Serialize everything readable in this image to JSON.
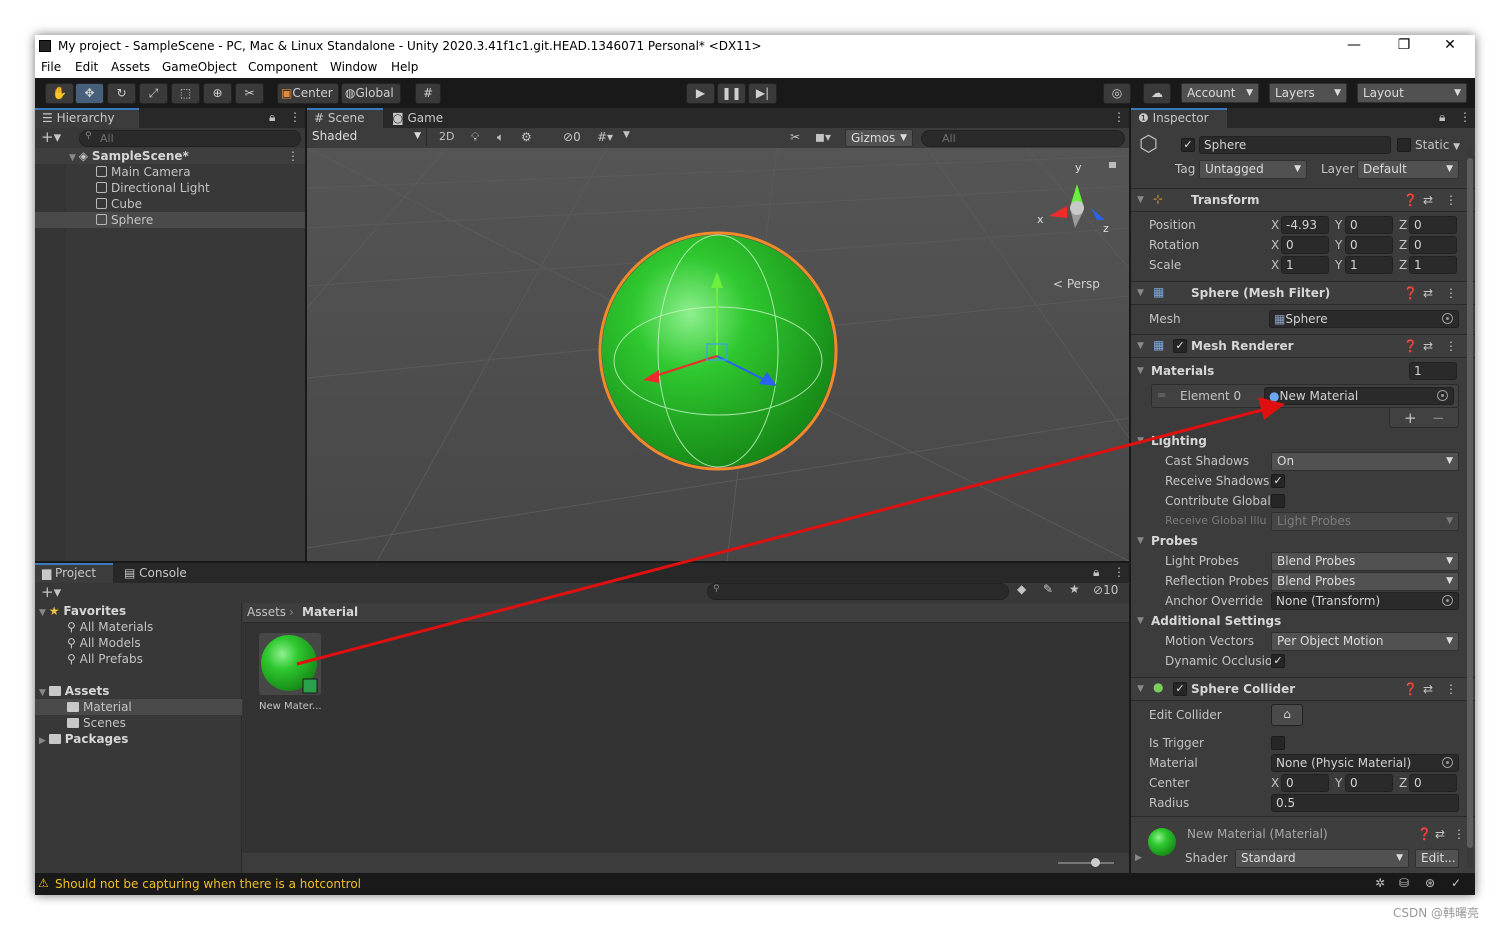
{
  "window": {
    "title": "My project - SampleScene - PC, Mac & Linux Standalone - Unity 2020.3.41f1c1.git.HEAD.1346071 Personal* <DX11>",
    "min": "—",
    "max": "❐",
    "close": "✕"
  },
  "menu": [
    "File",
    "Edit",
    "Assets",
    "GameObject",
    "Component",
    "Window",
    "Help"
  ],
  "toolbar": {
    "center": "Center",
    "global": "Global",
    "account": "Account",
    "layers": "Layers",
    "layout": "Layout"
  },
  "hierarchy": {
    "tab": "Hierarchy",
    "search_placeholder": "All",
    "scene": "SampleScene*",
    "items": [
      "Main Camera",
      "Directional Light",
      "Cube",
      "Sphere"
    ],
    "selected": "Sphere"
  },
  "scene": {
    "tabs": [
      "Scene",
      "Game"
    ],
    "shading": "Shaded",
    "mode_2d": "2D",
    "hidden_count": "0",
    "gizmos": "Gizmos",
    "search_placeholder": "All",
    "persp": "< Persp",
    "axis_x": "x",
    "axis_y": "y",
    "axis_z": "z"
  },
  "project": {
    "tabs": [
      "Project",
      "Console"
    ],
    "favorites": "Favorites",
    "fav_items": [
      "All Materials",
      "All Models",
      "All Prefabs"
    ],
    "assets": "Assets",
    "asset_items": [
      "Material",
      "Scenes"
    ],
    "packages": "Packages",
    "breadcrumb": [
      "Assets",
      "Material"
    ],
    "asset_tile": "New Mater...",
    "visibility_count": "10"
  },
  "inspector": {
    "tab": "Inspector",
    "name": "Sphere",
    "static": "Static",
    "tag_label": "Tag",
    "tag": "Untagged",
    "layer_label": "Layer",
    "layer": "Default",
    "transform": {
      "title": "Transform",
      "position": {
        "label": "Position",
        "x": "-4.93",
        "y": "0",
        "z": "0"
      },
      "rotation": {
        "label": "Rotation",
        "x": "0",
        "y": "0",
        "z": "0"
      },
      "scale": {
        "label": "Scale",
        "x": "1",
        "y": "1",
        "z": "1"
      }
    },
    "mesh_filter": {
      "title": "Sphere (Mesh Filter)",
      "mesh_label": "Mesh",
      "mesh": "Sphere"
    },
    "mesh_renderer": {
      "title": "Mesh Renderer",
      "materials": "Materials",
      "materials_count": "1",
      "element0": "Element 0",
      "element0_value": "New Material",
      "lighting": "Lighting",
      "cast_shadows": "Cast Shadows",
      "cast_shadows_value": "On",
      "receive_shadows": "Receive Shadows",
      "contribute_gi": "Contribute Global I",
      "receive_gi": "Receive Global Illu",
      "receive_gi_value": "Light Probes",
      "probes": "Probes",
      "light_probes": "Light Probes",
      "light_probes_value": "Blend Probes",
      "reflection_probes": "Reflection Probes",
      "reflection_probes_value": "Blend Probes",
      "anchor_override": "Anchor Override",
      "anchor_override_value": "None (Transform)",
      "additional": "Additional Settings",
      "motion_vectors": "Motion Vectors",
      "motion_vectors_value": "Per Object Motion",
      "dynamic_occlusion": "Dynamic Occlusioi"
    },
    "sphere_collider": {
      "title": "Sphere Collider",
      "edit_collider": "Edit Collider",
      "is_trigger": "Is Trigger",
      "material": "Material",
      "material_value": "None (Physic Material)",
      "center": "Center",
      "cx": "0",
      "cy": "0",
      "cz": "0",
      "radius": "Radius",
      "radius_value": "0.5"
    },
    "material": {
      "title": "New Material (Material)",
      "shader_label": "Shader",
      "shader": "Standard",
      "edit": "Edit..."
    }
  },
  "status": "Should not be capturing when there is a hotcontrol",
  "watermark": "CSDN @韩曙亮",
  "colors": {
    "sphere": "#2fc82f",
    "selection_outline": "#f28a2a",
    "annotation_arrow": "#e01010",
    "accent": "#3a79bb"
  }
}
